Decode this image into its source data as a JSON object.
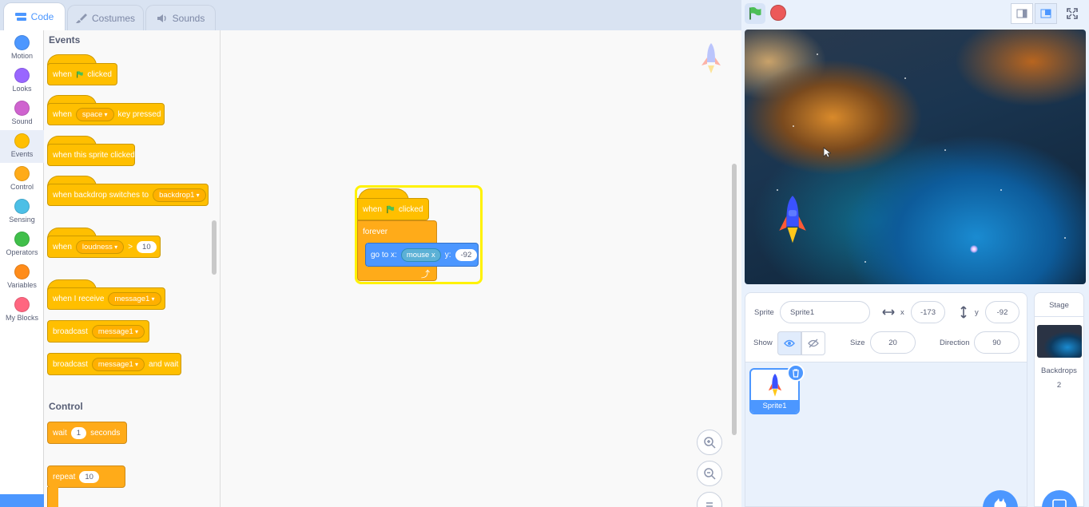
{
  "tabs": [
    {
      "label": "Code"
    },
    {
      "label": "Costumes"
    },
    {
      "label": "Sounds"
    }
  ],
  "categories": [
    {
      "label": "Motion",
      "color": "#4c97ff"
    },
    {
      "label": "Looks",
      "color": "#9966ff"
    },
    {
      "label": "Sound",
      "color": "#cf63cf"
    },
    {
      "label": "Events",
      "color": "#ffbf00"
    },
    {
      "label": "Control",
      "color": "#ffab19"
    },
    {
      "label": "Sensing",
      "color": "#4cbfe6"
    },
    {
      "label": "Operators",
      "color": "#40bf4a"
    },
    {
      "label": "Variables",
      "color": "#ff8c1a"
    },
    {
      "label": "My Blocks",
      "color": "#ff6680"
    }
  ],
  "palette": {
    "events_title": "Events",
    "control_title": "Control",
    "b1": {
      "when": "when",
      "clicked": "clicked"
    },
    "b2": {
      "when": "when",
      "key": "space",
      "suffix": "key pressed"
    },
    "b3": {
      "text": "when this sprite clicked"
    },
    "b4": {
      "text": "when backdrop switches to",
      "value": "backdrop1"
    },
    "b5": {
      "when": "when",
      "sensor": "loudness",
      "op": ">",
      "value": "10"
    },
    "b6": {
      "text": "when I receive",
      "value": "message1"
    },
    "b7": {
      "text": "broadcast",
      "value": "message1"
    },
    "b8": {
      "text": "broadcast",
      "value": "message1",
      "suffix": "and wait"
    },
    "c1": {
      "text": "wait",
      "value": "1",
      "suffix": "seconds"
    },
    "c2": {
      "text": "repeat",
      "value": "10"
    }
  },
  "script": {
    "when": "when",
    "clicked": "clicked",
    "forever": "forever",
    "goto": "go to x:",
    "reporter": "mouse x",
    "y_label": "y:",
    "y_value": "-92"
  },
  "sprite_info": {
    "sprite_label": "Sprite",
    "sprite_name": "Sprite1",
    "x_label": "x",
    "x_value": "-173",
    "y_label": "y",
    "y_value": "-92",
    "show_label": "Show",
    "size_label": "Size",
    "size_value": "20",
    "direction_label": "Direction",
    "direction_value": "90"
  },
  "sprites": [
    {
      "name": "Sprite1"
    }
  ],
  "stage_panel": {
    "title": "Stage",
    "backdrops_label": "Backdrops",
    "backdrops_count": "2"
  }
}
